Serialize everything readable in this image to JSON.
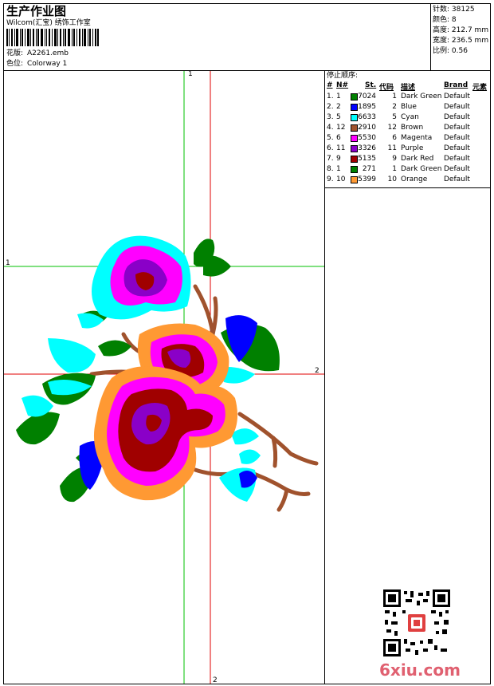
{
  "header": {
    "title": "生产作业图",
    "company": "Wilcom(汇宝) 绣饰工作室",
    "design_label": "花版:",
    "design_value": "A2261.emb",
    "colorway_label": "色位:",
    "colorway_value": "Colorway 1"
  },
  "stats": {
    "stitches_label": "针数:",
    "stitches_value": "38125",
    "colors_label": "颜色:",
    "colors_value": "8",
    "height_label": "高度:",
    "height_value": "212.7 mm",
    "width_label": "宽度:",
    "width_value": "236.5 mm",
    "scale_label": "比例:",
    "scale_value": "0.56"
  },
  "sequence": {
    "title": "停止顺序:",
    "headers": {
      "num": "#",
      "no": "N#",
      "st": "St.",
      "code": "代码",
      "desc": "描述",
      "brand": "Brand",
      "elem": "元素"
    },
    "rows": [
      {
        "num": "1.",
        "no": "1",
        "color": "#008000",
        "st": "7024",
        "code": "1",
        "desc": "Dark Green",
        "brand": "Default"
      },
      {
        "num": "2.",
        "no": "2",
        "color": "#0000FF",
        "st": "1895",
        "code": "2",
        "desc": "Blue",
        "brand": "Default"
      },
      {
        "num": "3.",
        "no": "5",
        "color": "#00FFFF",
        "st": "6633",
        "code": "5",
        "desc": "Cyan",
        "brand": "Default"
      },
      {
        "num": "4.",
        "no": "12",
        "color": "#A0522D",
        "st": "2910",
        "code": "12",
        "desc": "Brown",
        "brand": "Default"
      },
      {
        "num": "5.",
        "no": "6",
        "color": "#FF00FF",
        "st": "5530",
        "code": "6",
        "desc": "Magenta",
        "brand": "Default"
      },
      {
        "num": "6.",
        "no": "11",
        "color": "#8A00C8",
        "st": "3326",
        "code": "11",
        "desc": "Purple",
        "brand": "Default"
      },
      {
        "num": "7.",
        "no": "9",
        "color": "#A00000",
        "st": "5135",
        "code": "9",
        "desc": "Dark Red",
        "brand": "Default"
      },
      {
        "num": "8.",
        "no": "1",
        "color": "#008000",
        "st": "271",
        "code": "1",
        "desc": "Dark Green",
        "brand": "Default"
      },
      {
        "num": "9.",
        "no": "10",
        "color": "#FF9933",
        "st": "5399",
        "code": "10",
        "desc": "Orange",
        "brand": "Default"
      }
    ]
  },
  "guides": {
    "g1": "1",
    "g2": "2"
  },
  "watermark": "6xiu.com",
  "colors": {
    "guide_green": "#00C000",
    "guide_red": "#E00000",
    "watermark": "#E06070"
  }
}
